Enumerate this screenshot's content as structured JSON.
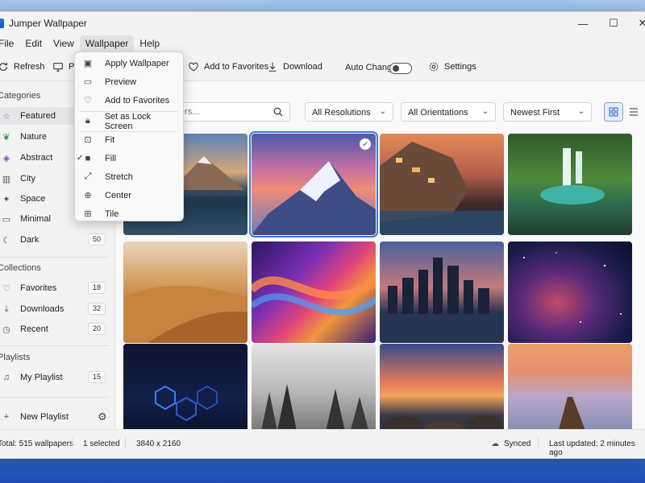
{
  "window": {
    "title": "Jumper Wallpaper",
    "controls": {
      "minimize": "—",
      "maximize": "☐",
      "close": "✕"
    }
  },
  "menubar": {
    "items": [
      "File",
      "Edit",
      "View",
      "Wallpaper",
      "Help"
    ],
    "open_index": 3
  },
  "toolbar": {
    "refresh": "Refresh",
    "preview": "Pr",
    "add_favorites": "Add to Favorites",
    "download": "Download",
    "auto_change": "Auto Change",
    "auto_change_on": false,
    "settings": "Settings"
  },
  "sidebar": {
    "categories_title": "Categories",
    "categories": [
      {
        "label": "Featured",
        "icon": "star-icon",
        "count": ""
      },
      {
        "label": "Nature",
        "icon": "leaf-icon",
        "count": ""
      },
      {
        "label": "Abstract",
        "icon": "abstract-icon",
        "count": ""
      },
      {
        "label": "City",
        "icon": "city-icon",
        "count": ""
      },
      {
        "label": "Space",
        "icon": "space-icon",
        "count": ""
      },
      {
        "label": "Minimal",
        "icon": "minimal-icon",
        "count": ""
      },
      {
        "label": "Dark",
        "icon": "moon-icon",
        "count": "50"
      }
    ],
    "collections_title": "Collections",
    "collections": [
      {
        "label": "Favorites",
        "icon": "heart-icon",
        "count": "18"
      },
      {
        "label": "Downloads",
        "icon": "download-icon",
        "count": "32"
      },
      {
        "label": "Recent",
        "icon": "clock-icon",
        "count": "20"
      }
    ],
    "playlists_title": "Playlists",
    "playlists": [
      {
        "label": "My Playlist",
        "icon": "playlist-icon",
        "count": "15"
      }
    ],
    "new_playlist": "New Playlist"
  },
  "filters": {
    "search_placeholder": "ers...",
    "resolution": "All Resolutions",
    "orientation": "All Orientations",
    "sort": "Newest First"
  },
  "context_menu": {
    "items": [
      {
        "label": "Apply Wallpaper",
        "icon": "image-icon"
      },
      {
        "label": "Preview",
        "icon": "preview-icon"
      },
      {
        "label": "Add to Favorites",
        "icon": "heart-icon"
      },
      {
        "label": "Set as Lock Screen",
        "icon": "lock-icon"
      },
      {
        "label": "Fit",
        "icon": "fit-icon"
      },
      {
        "label": "Fill",
        "icon": "fill-icon",
        "checked": true
      },
      {
        "label": "Stretch",
        "icon": "stretch-icon"
      },
      {
        "label": "Center",
        "icon": "center-icon"
      },
      {
        "label": "Tile",
        "icon": "tile-icon"
      }
    ]
  },
  "wallpapers": [
    {
      "name": "mountain-lake"
    },
    {
      "name": "snowy-peak-sunset",
      "selected": true
    },
    {
      "name": "cliff-village"
    },
    {
      "name": "jungle-waterfall"
    },
    {
      "name": "desert-dunes"
    },
    {
      "name": "abstract-waves"
    },
    {
      "name": "city-skyline"
    },
    {
      "name": "nebula"
    },
    {
      "name": "hexagon-dark"
    },
    {
      "name": "misty-forest"
    },
    {
      "name": "rocky-sunset-coast"
    },
    {
      "name": "pier-sunset"
    }
  ],
  "status": {
    "total": "Total: 515 wallpapers",
    "selected": "1 selected",
    "resolution": "3840 x 2160",
    "synced": "Synced",
    "updated": "Last updated: 2 minutes ago"
  },
  "colors": {
    "accent": "#3b79d8"
  }
}
